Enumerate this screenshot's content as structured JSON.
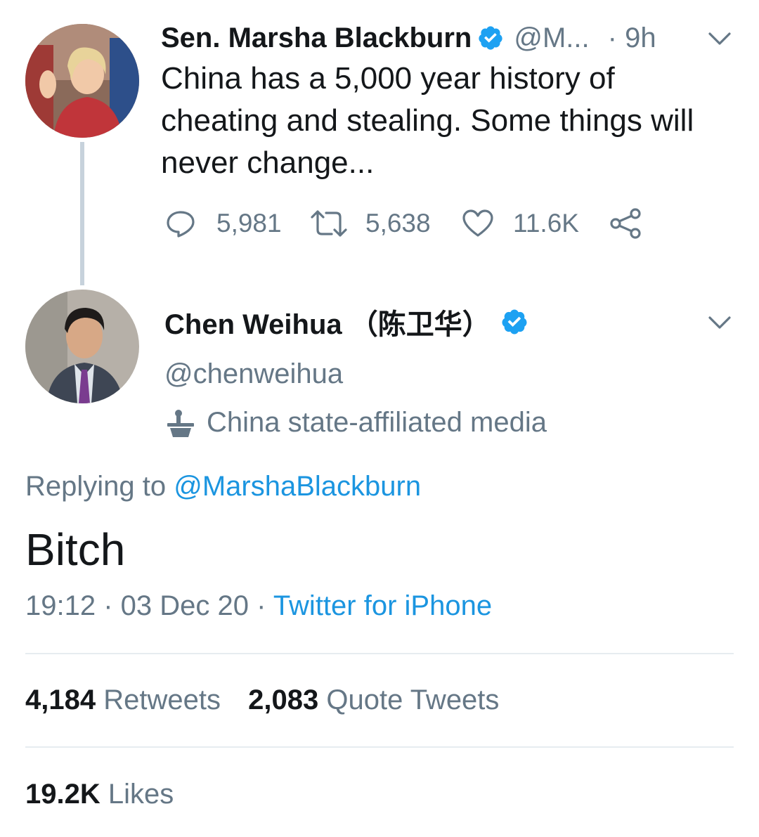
{
  "parent_tweet": {
    "author_name": "Sen. Marsha Blackburn",
    "author_handle": "@M...",
    "time": "· 9h",
    "text": "China has a 5,000 year history of cheating and stealing. Some things will never change...",
    "reply_count": "5,981",
    "retweet_count": "5,638",
    "like_count": "11.6K"
  },
  "main_tweet": {
    "author_name": "Chen Weihua （陈卫华）",
    "author_handle": "@chenweihua",
    "affiliation_label": "China state-affiliated media",
    "replying_prefix": "Replying to",
    "replying_handle": "@MarshaBlackburn",
    "text": "Bitch",
    "timestamp": "19:12 · 03 Dec 20 ·",
    "source": "Twitter for iPhone",
    "retweets_count": "4,184",
    "retweets_label": "Retweets",
    "quote_count": "2,083",
    "quote_label": "Quote Tweets",
    "likes_count": "19.2K",
    "likes_label": "Likes"
  },
  "colors": {
    "link": "#1b95e0",
    "muted": "#657786",
    "verified": "#1da1f2",
    "thread_line": "#c7d2dc"
  }
}
